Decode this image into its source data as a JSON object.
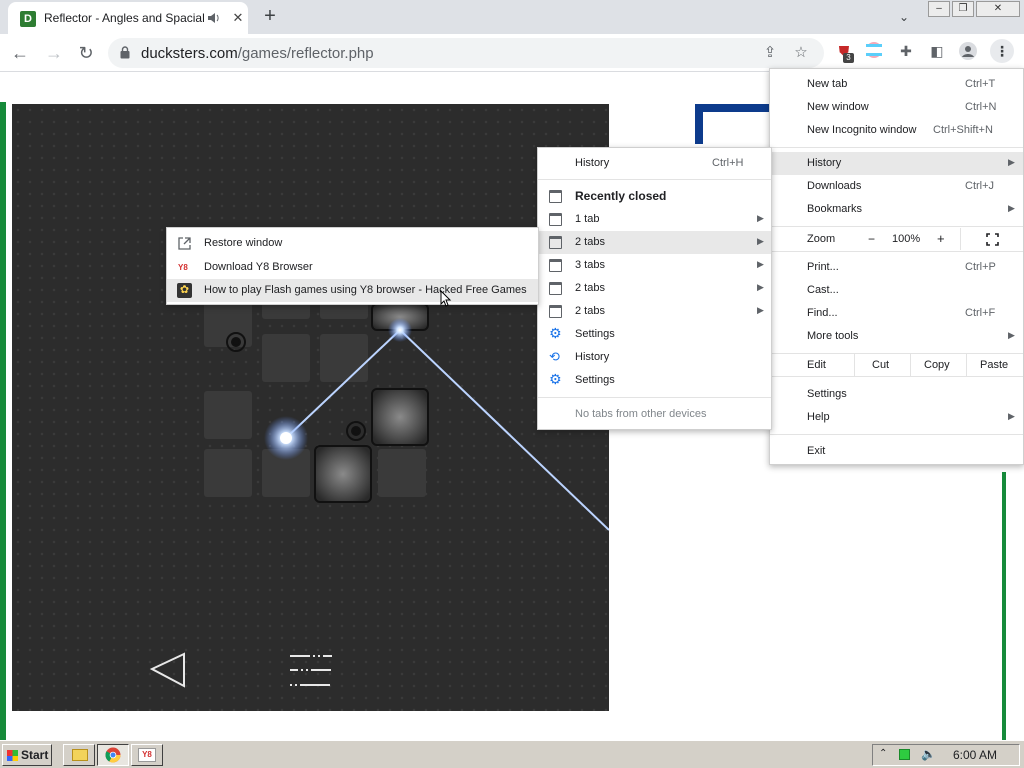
{
  "browser": {
    "tab_title": "Reflector - Angles and Spacial Logic",
    "favicon_letter": "D",
    "url_host": "ducksters.com",
    "url_path": "/games/reflector.php",
    "extension_badge": "3"
  },
  "main_menu": {
    "items": [
      {
        "label": "New tab",
        "shortcut": "Ctrl+T"
      },
      {
        "label": "New window",
        "shortcut": "Ctrl+N"
      },
      {
        "label": "New Incognito window",
        "shortcut": "Ctrl+Shift+N"
      },
      {
        "label": "History",
        "shortcut": ""
      },
      {
        "label": "Downloads",
        "shortcut": "Ctrl+J"
      },
      {
        "label": "Bookmarks",
        "shortcut": ""
      },
      {
        "label": "Print...",
        "shortcut": "Ctrl+P"
      },
      {
        "label": "Cast...",
        "shortcut": ""
      },
      {
        "label": "Find...",
        "shortcut": "Ctrl+F"
      },
      {
        "label": "More tools",
        "shortcut": ""
      },
      {
        "label": "Settings",
        "shortcut": ""
      },
      {
        "label": "Help",
        "shortcut": ""
      },
      {
        "label": "Exit",
        "shortcut": ""
      }
    ],
    "zoom": {
      "label": "Zoom",
      "minus": "−",
      "value": "100%",
      "plus": "+"
    },
    "edit": {
      "label": "Edit",
      "cut": "Cut",
      "copy": "Copy",
      "paste": "Paste"
    }
  },
  "history_menu": {
    "history": {
      "label": "History",
      "shortcut": "Ctrl+H"
    },
    "recently_closed": "Recently closed",
    "entries": [
      "1 tab",
      "2 tabs",
      "3 tabs",
      "2 tabs",
      "2 tabs",
      "Settings",
      "History",
      "Settings"
    ],
    "footer": "No tabs from other devices"
  },
  "tabs_submenu": {
    "items": [
      {
        "label": "Restore window",
        "icon": "restore-window-icon"
      },
      {
        "label": "Download Y8 Browser",
        "icon": "y8-icon"
      },
      {
        "label": "How to play Flash games using Y8 browser - Hacked Free Games",
        "icon": "game-favicon-icon"
      }
    ]
  },
  "taskbar": {
    "start": "Start",
    "clock": "6:00 AM"
  }
}
